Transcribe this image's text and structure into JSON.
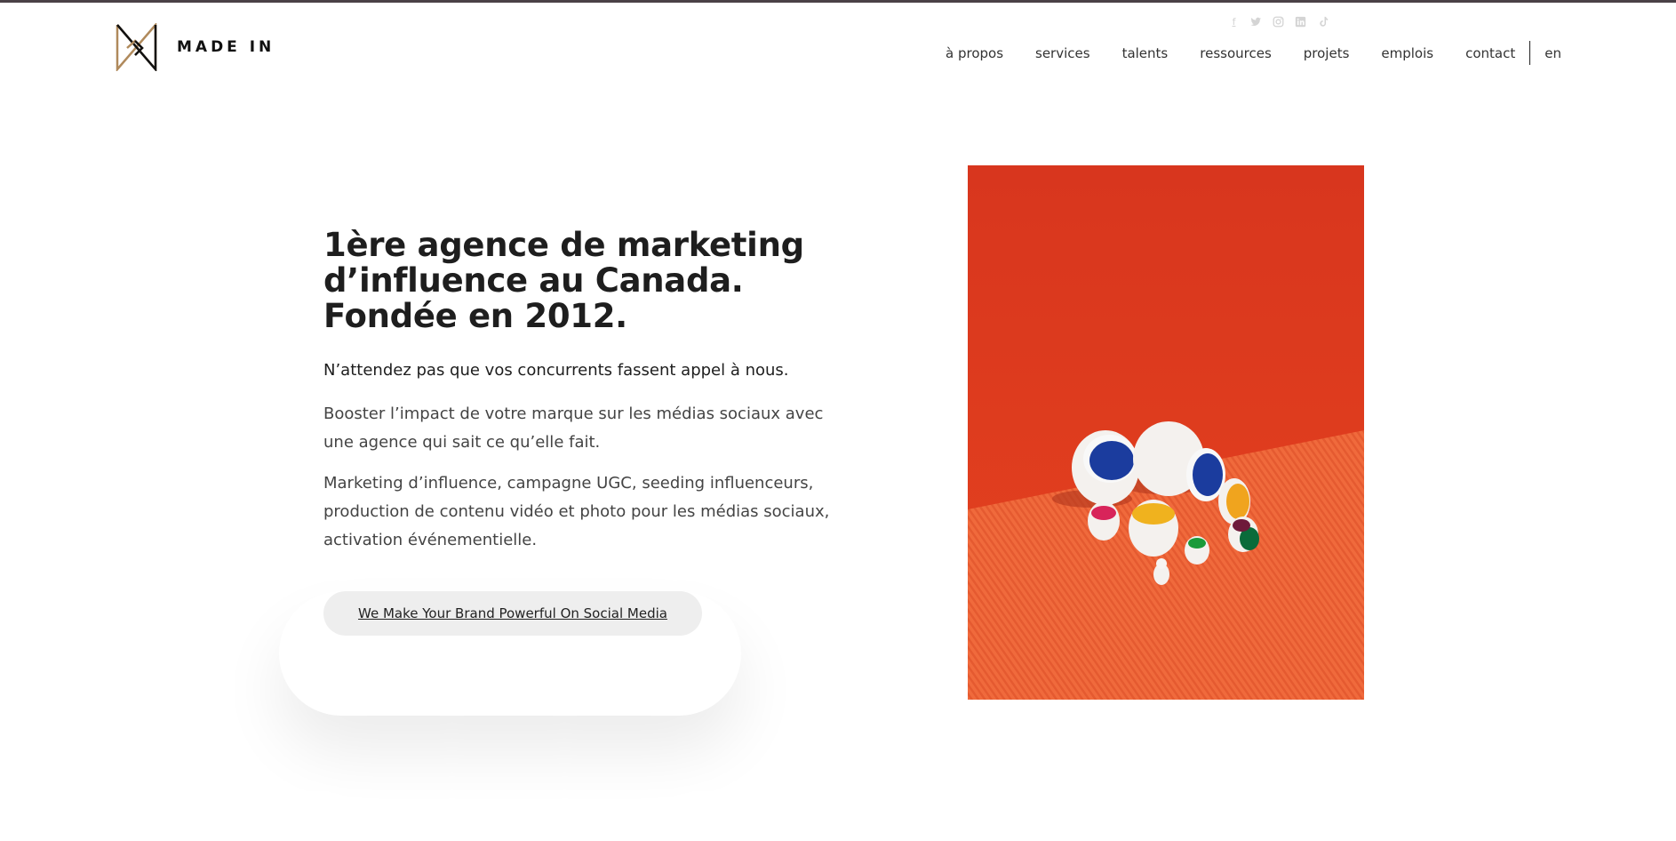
{
  "brand": {
    "name": "MADE IN",
    "colors": {
      "gold": "#b08a5c",
      "dark": "#1a1a1a",
      "accent_orange": "#e8462a"
    }
  },
  "social": [
    {
      "icon": "facebook-icon",
      "glyph": "f"
    },
    {
      "icon": "twitter-icon",
      "glyph": "t"
    },
    {
      "icon": "instagram-icon",
      "glyph": "◎"
    },
    {
      "icon": "linkedin-icon",
      "glyph": "in"
    },
    {
      "icon": "tiktok-icon",
      "glyph": "♪"
    }
  ],
  "nav": {
    "items": [
      "à propos",
      "services",
      "talents",
      "ressources",
      "projets",
      "emplois",
      "contact"
    ],
    "lang": "en"
  },
  "hero": {
    "title": "1ère agence de marketing d’influence au Canada. Fondée en 2012.",
    "subtitle": "N’attendez pas que vos concurrents fassent appel à nous.",
    "paragraph1": "Booster l’impact de votre marque sur les médias sociaux avec une agence qui sait ce qu’elle fait.",
    "paragraph2": "Marketing d’influence, campagne UGC, seeding influenceurs, production de contenu vidéo et photo pour les médias sociaux, activation événementielle.",
    "cta_label": "We Make Your Brand Powerful On Social Media"
  }
}
